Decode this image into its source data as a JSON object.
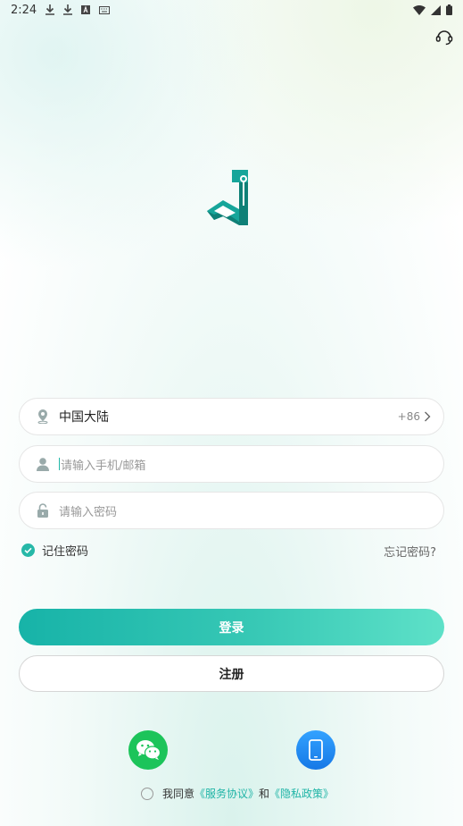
{
  "status_bar": {
    "time": "2:24"
  },
  "colors": {
    "accent": "#1fb4a6",
    "wechat": "#1cc45a",
    "phone": "#1e88f0"
  },
  "icons": {
    "support": "headset-icon",
    "logo": "app-logo",
    "region": "location-pin-icon",
    "user": "user-icon",
    "password": "lock-icon",
    "remember": "check-circle-icon",
    "wechat": "wechat-icon",
    "phone": "smartphone-icon"
  },
  "form": {
    "region_label": "中国大陆",
    "country_code": "+86",
    "account_placeholder": "请输入手机/邮箱",
    "password_placeholder": "请输入密码",
    "remember_label": "记住密码",
    "remember_checked": true,
    "forgot_label": "忘记密码?"
  },
  "buttons": {
    "login": "登录",
    "register": "注册"
  },
  "agreement": {
    "prefix": "我同意",
    "service_link": "《服务协议》",
    "and": "和",
    "privacy_link": "《隐私政策》",
    "checked": false
  }
}
